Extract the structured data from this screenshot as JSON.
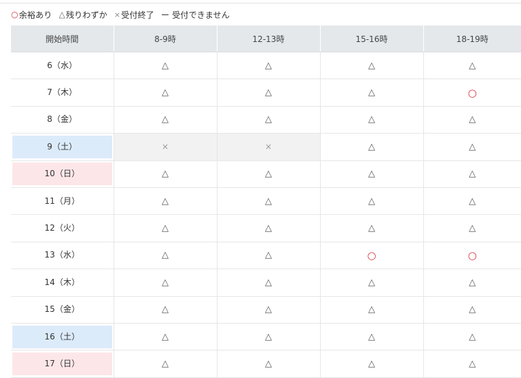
{
  "legend": [
    {
      "symbol": "○",
      "label": "余裕あり",
      "kind": "ok"
    },
    {
      "symbol": "△",
      "label": "残りわずか",
      "kind": "few"
    },
    {
      "symbol": "×",
      "label": "受付終了",
      "kind": "closed"
    },
    {
      "symbol": "ー",
      "label": "受付できません",
      "kind": "dash"
    }
  ],
  "table": {
    "header": [
      "開始時間",
      "8-9時",
      "12-13時",
      "15-16時",
      "18-19時"
    ],
    "rows": [
      {
        "date": "6（水）",
        "day_type": "weekday",
        "slots": [
          "△",
          "△",
          "△",
          "△"
        ]
      },
      {
        "date": "7（木）",
        "day_type": "weekday",
        "slots": [
          "△",
          "△",
          "△",
          "○"
        ]
      },
      {
        "date": "8（金）",
        "day_type": "weekday",
        "slots": [
          "△",
          "△",
          "△",
          "△"
        ]
      },
      {
        "date": "9（土）",
        "day_type": "sat",
        "slots": [
          "×",
          "×",
          "△",
          "△"
        ]
      },
      {
        "date": "10（日）",
        "day_type": "sun",
        "slots": [
          "△",
          "△",
          "△",
          "△"
        ]
      },
      {
        "date": "11（月）",
        "day_type": "weekday",
        "slots": [
          "△",
          "△",
          "△",
          "△"
        ]
      },
      {
        "date": "12（火）",
        "day_type": "weekday",
        "slots": [
          "△",
          "△",
          "△",
          "△"
        ]
      },
      {
        "date": "13（水）",
        "day_type": "weekday",
        "slots": [
          "△",
          "△",
          "○",
          "○"
        ]
      },
      {
        "date": "14（木）",
        "day_type": "weekday",
        "slots": [
          "△",
          "△",
          "△",
          "△"
        ]
      },
      {
        "date": "15（金）",
        "day_type": "weekday",
        "slots": [
          "△",
          "△",
          "△",
          "△"
        ]
      },
      {
        "date": "16（土）",
        "day_type": "sat",
        "slots": [
          "△",
          "△",
          "△",
          "△"
        ]
      },
      {
        "date": "17（日）",
        "day_type": "sun",
        "slots": [
          "△",
          "△",
          "△",
          "△"
        ]
      }
    ]
  },
  "colors": {
    "available": "#d9363e",
    "saturday_bg": "#dcebfa",
    "sunday_bg": "#fde6e8",
    "header_bg": "#e4e8eb",
    "closed_bg": "#f2f2f2"
  }
}
